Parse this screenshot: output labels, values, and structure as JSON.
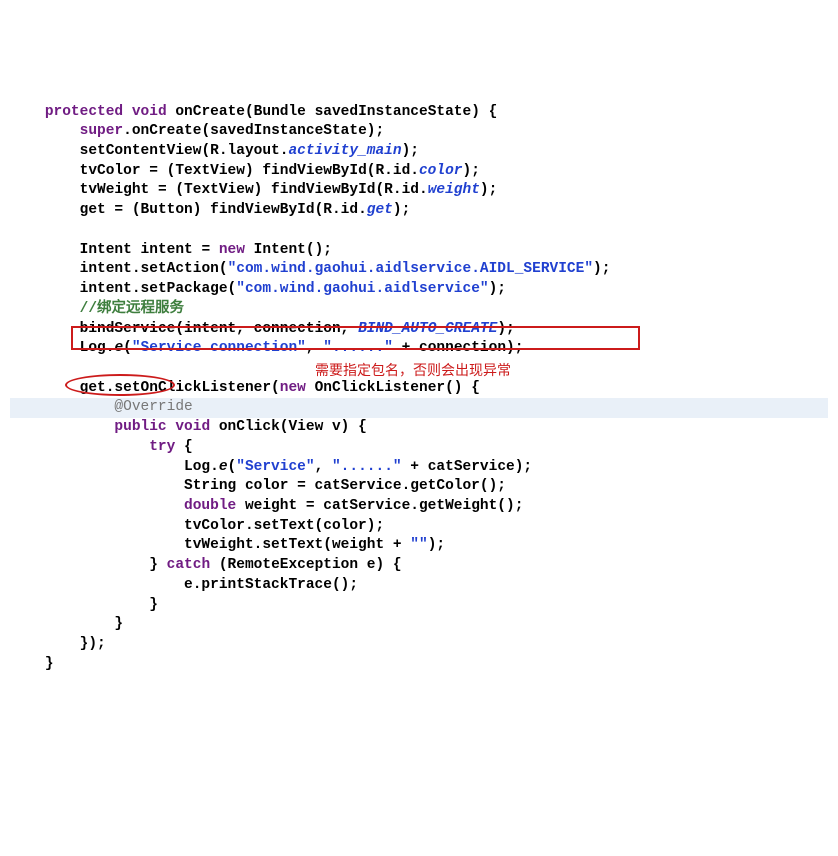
{
  "kw": {
    "protected": "protected",
    "void": "void",
    "super": "super",
    "new": "new",
    "public": "public",
    "try": "try",
    "catch": "catch",
    "double": "double"
  },
  "code": {
    "onCreate_sig": " onCreate(Bundle savedInstanceState) {",
    "super_rest": ".onCreate(savedInstanceState);",
    "setContentView_pre": "setContentView(R.layout.",
    "activity_main": "activity_main",
    "close_paren_semi": ");",
    "tvColor_pre": "tvColor = (TextView) findViewById(R.id.",
    "color": "color",
    "tvWeight_pre": "tvWeight = (TextView) findViewById(R.id.",
    "weight": "weight",
    "get_pre": "get = (Button) findViewById(R.id.",
    "get": "get",
    "intent_decl_pre": "Intent intent = ",
    "intent_decl_post": " Intent();",
    "setAction_pre": "intent.setAction(",
    "action_str": "\"com.wind.gaohui.aidlservice.AIDL_SERVICE\"",
    "setPackage_pre": "intent.setPackage(",
    "package_str": "\"com.wind.gaohui.aidlservice\"",
    "comment_bind": "//绑定远程服务",
    "bindService_pre": "bindService(intent, connection, ",
    "bind_auto_create": "BIND_AUTO_CREATE",
    "log_pre": "Log.",
    "log_e": "e",
    "log_open": "(",
    "log_conn_str": "\"Service connection\"",
    "log_mid": ", ",
    "dots_str": "\"......\"",
    "log_post": " + connection);",
    "getset_pre": "get.setOnClickListener(",
    "getset_post": " OnClickListener() {",
    "override": "@Override",
    "onclick_sig": " onClick(View v) {",
    "try_open": " {",
    "log_svc_str": "\"Service\"",
    "log_cat_post": " + catService);",
    "string_color": "String color = catService.getColor();",
    "double_weight": " weight = catService.getWeight();",
    "tvColor_set": "tvColor.setText(color);",
    "tvWeight_set_pre": "tvWeight.setText(weight + ",
    "empty_str": "\"\"",
    "catch_post": " (RemoteException e) {",
    "printStack": "e.printStackTrace();",
    "brace_close": "}",
    "anon_close": "});"
  },
  "annot": {
    "red_note": "需要指定包名，否则会出现异常"
  },
  "ind": {
    "i1": "    ",
    "i2": "        ",
    "i3": "            ",
    "i4": "                ",
    "i5": "                    ",
    "i6": "                        "
  }
}
